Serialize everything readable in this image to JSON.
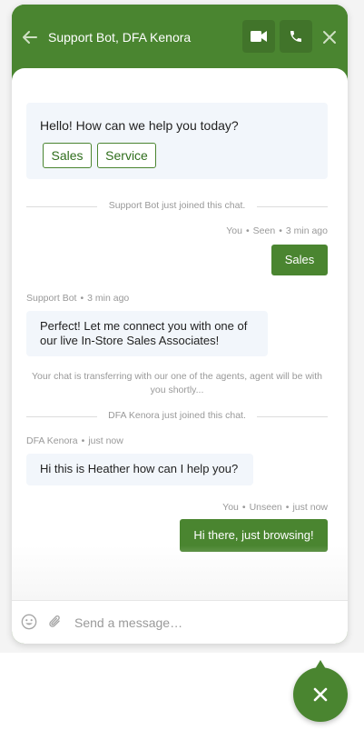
{
  "header": {
    "title": "Support Bot, DFA Kenora",
    "back_icon": "arrow-left-icon",
    "video_icon": "video-camera-icon",
    "phone_icon": "phone-icon",
    "close_icon": "close-icon"
  },
  "greeting": {
    "text": "Hello! How can we help you today?",
    "options": [
      "Sales",
      "Service"
    ]
  },
  "events": {
    "bot_joined": "Support Bot just joined this chat.",
    "transfer_notice": "Your chat is transferring with our one of the agents, agent will be with you shortly...",
    "agent_joined": "DFA Kenora just joined this chat."
  },
  "messages": [
    {
      "author": "You",
      "status": "Seen",
      "time": "3 min ago",
      "text": "Sales"
    },
    {
      "author": "Support Bot",
      "time": "3 min ago",
      "text": "Perfect! Let me connect you with one of our live In-Store Sales Associates!"
    },
    {
      "author": "DFA Kenora",
      "time": "just now",
      "text": "Hi this is Heather how can I help you?"
    },
    {
      "author": "You",
      "status": "Unseen",
      "time": "just now",
      "text": "Hi there, just browsing!"
    }
  ],
  "composer": {
    "placeholder": "Send a message…",
    "emoji_icon": "emoji-icon",
    "attach_icon": "paperclip-icon"
  },
  "launcher": {
    "icon": "close-icon"
  },
  "colors": {
    "brand": "#4a8530",
    "bubble_in": "#f2f6fb",
    "muted": "#999999"
  }
}
